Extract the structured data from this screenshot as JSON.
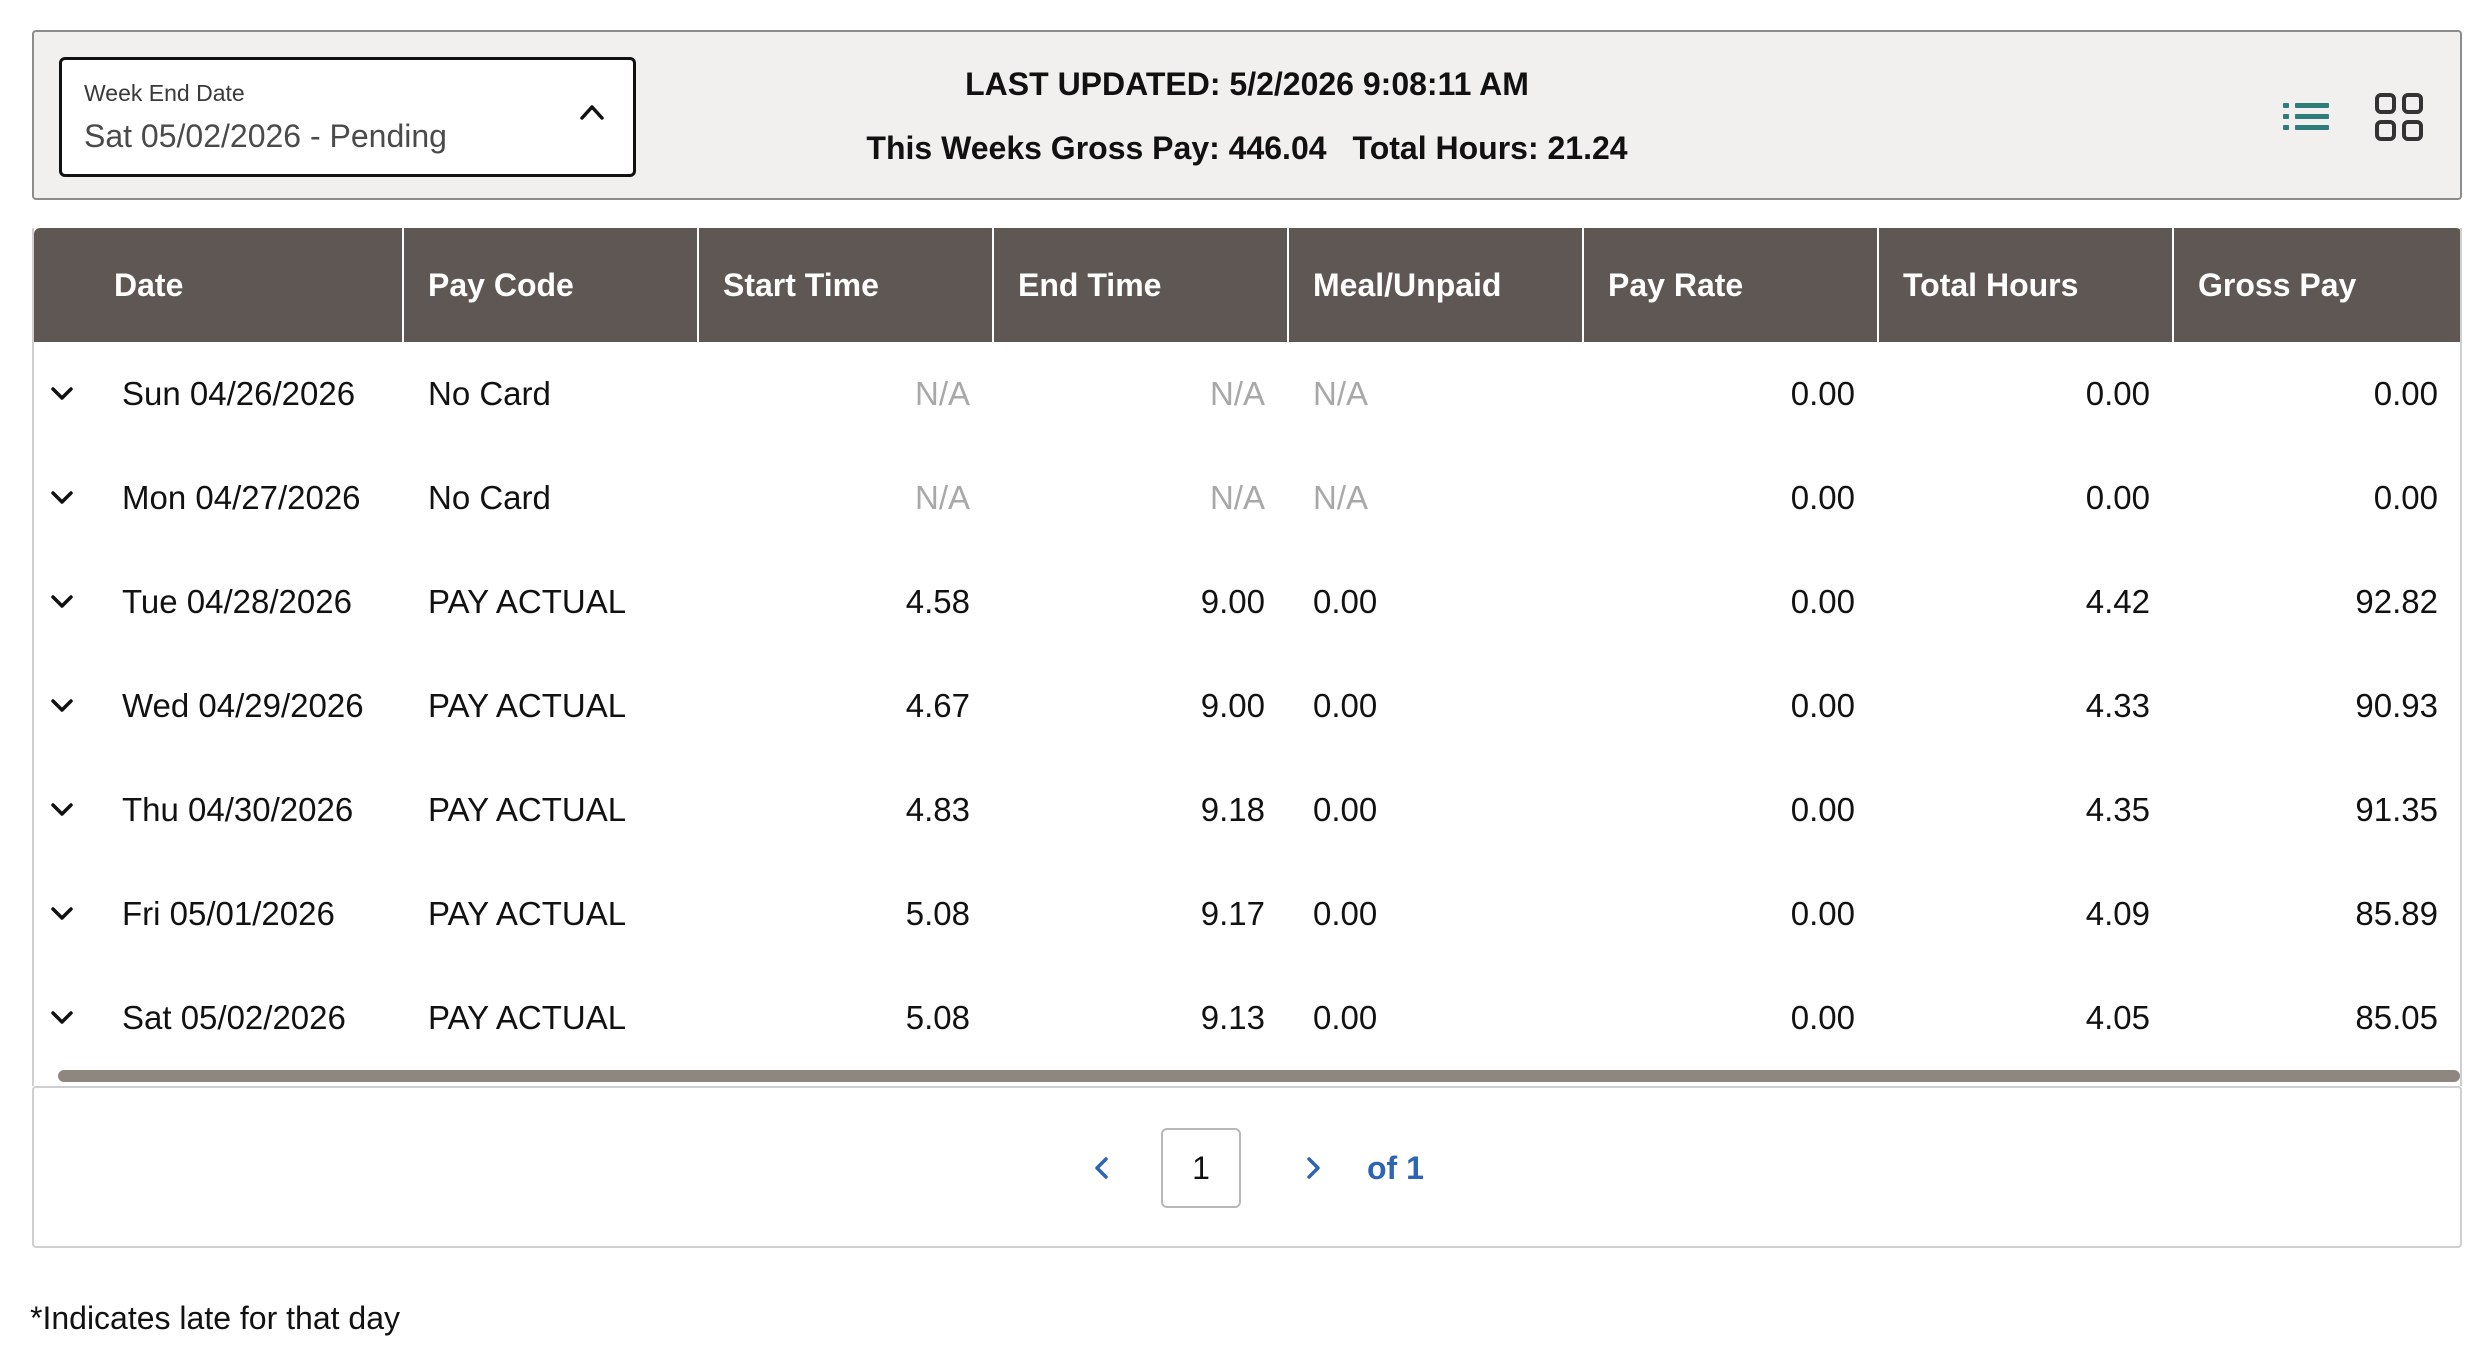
{
  "header": {
    "week_select": {
      "label": "Week End Date",
      "value": "Sat 05/02/2026 - Pending"
    },
    "last_updated": "LAST UPDATED: 5/2/2026 9:08:11 AM",
    "gross_pay_text": "This Weeks Gross Pay: 446.04",
    "total_hours_text": "Total Hours: 21.24",
    "icons": {
      "list_view": "list-icon",
      "grid_view": "grid-icon"
    },
    "accent_color": "#2e7d7a"
  },
  "table": {
    "header_bg": "#5f5753",
    "columns": [
      "Date",
      "Pay Code",
      "Start Time",
      "End Time",
      "Meal/Unpaid",
      "Pay Rate",
      "Total Hours",
      "Gross Pay"
    ],
    "rows": [
      {
        "date": "Sun 04/26/2026",
        "pay_code": "No Card",
        "start": "N/A",
        "end": "N/A",
        "meal": "N/A",
        "rate": "0.00",
        "hours": "0.00",
        "gross": "0.00"
      },
      {
        "date": "Mon 04/27/2026",
        "pay_code": "No Card",
        "start": "N/A",
        "end": "N/A",
        "meal": "N/A",
        "rate": "0.00",
        "hours": "0.00",
        "gross": "0.00"
      },
      {
        "date": "Tue 04/28/2026",
        "pay_code": "PAY ACTUAL",
        "start": "4.58",
        "end": "9.00",
        "meal": "0.00",
        "rate": "0.00",
        "hours": "4.42",
        "gross": "92.82"
      },
      {
        "date": "Wed 04/29/2026",
        "pay_code": "PAY ACTUAL",
        "start": "4.67",
        "end": "9.00",
        "meal": "0.00",
        "rate": "0.00",
        "hours": "4.33",
        "gross": "90.93"
      },
      {
        "date": "Thu 04/30/2026",
        "pay_code": "PAY ACTUAL",
        "start": "4.83",
        "end": "9.18",
        "meal": "0.00",
        "rate": "0.00",
        "hours": "4.35",
        "gross": "91.35"
      },
      {
        "date": "Fri 05/01/2026",
        "pay_code": "PAY ACTUAL",
        "start": "5.08",
        "end": "9.17",
        "meal": "0.00",
        "rate": "0.00",
        "hours": "4.09",
        "gross": "85.89"
      },
      {
        "date": "Sat 05/02/2026",
        "pay_code": "PAY ACTUAL",
        "start": "5.08",
        "end": "9.13",
        "meal": "0.00",
        "rate": "0.00",
        "hours": "4.05",
        "gross": "85.05"
      }
    ]
  },
  "pagination": {
    "current_page": "1",
    "of_text": "of 1",
    "link_color": "#2d64b3"
  },
  "footnote": "*Indicates late for that day"
}
